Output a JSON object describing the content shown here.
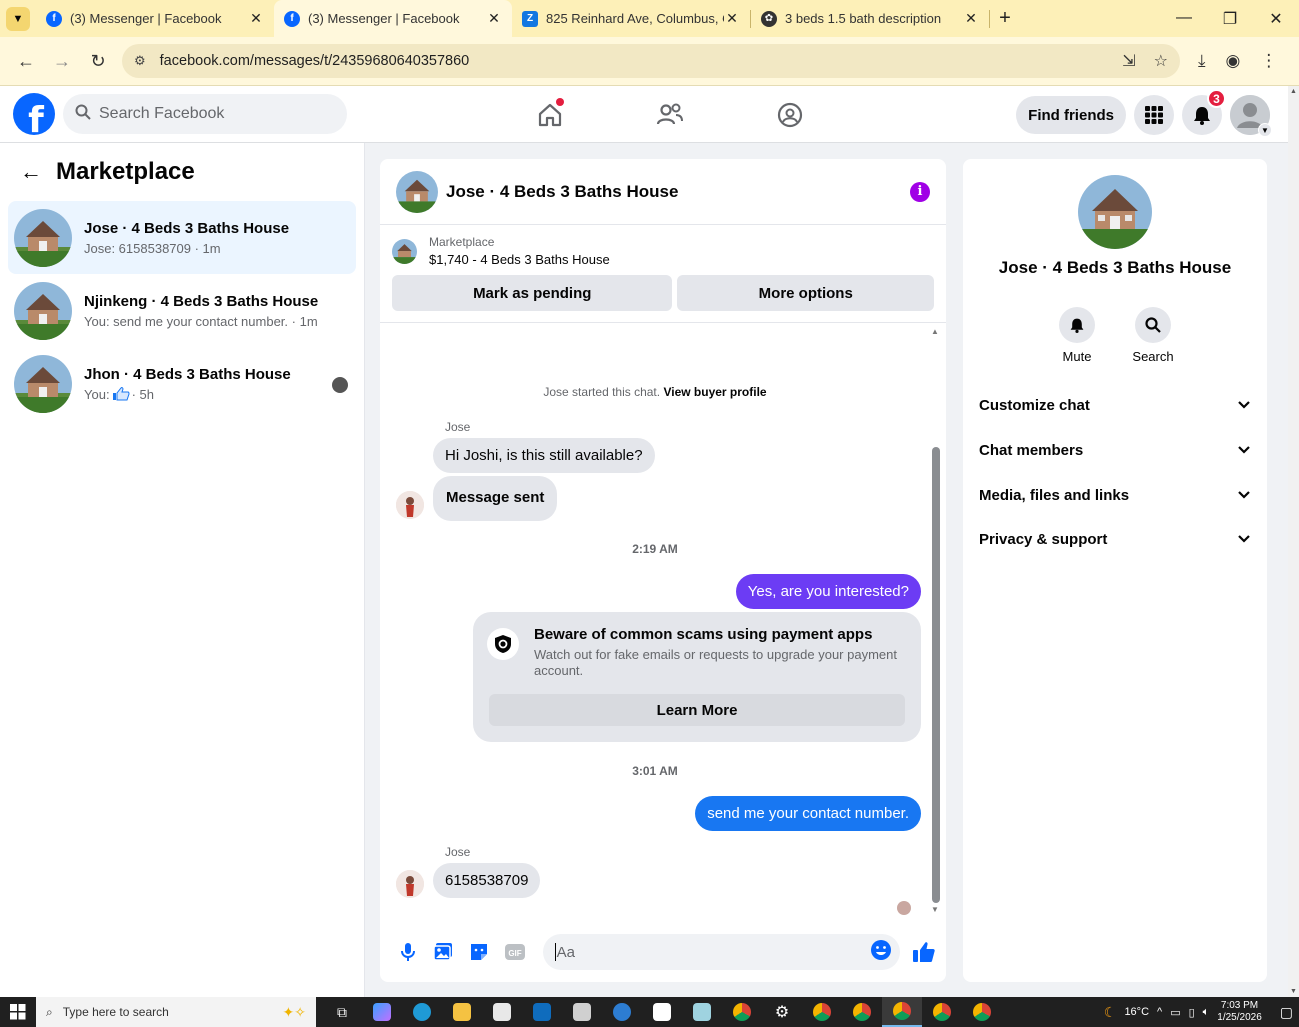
{
  "browser": {
    "tabs": [
      {
        "title": "(3) Messenger | Facebook",
        "icon": "facebook-icon",
        "active": false
      },
      {
        "title": "(3) Messenger | Facebook",
        "icon": "facebook-icon",
        "active": true
      },
      {
        "title": "825 Reinhard Ave, Columbus, O",
        "icon": "zillow-icon",
        "active": false
      },
      {
        "title": "3 beds 1.5 bath description",
        "icon": "chatgpt-icon",
        "active": false
      }
    ],
    "url": "facebook.com/messages/t/24359680640357860"
  },
  "fb": {
    "search_placeholder": "Search Facebook",
    "find_friends": "Find friends",
    "notifications_count": "3"
  },
  "left": {
    "title": "Marketplace",
    "conversations": [
      {
        "name": "Jose · 4 Beds 3 Baths House",
        "snippet": "Jose: 6158538709 · 1m",
        "selected": true
      },
      {
        "name": "Njinkeng · 4 Beds 3 Baths House",
        "snippet": "You: send me your contact number. · 1m",
        "selected": false
      },
      {
        "name": "Jhon · 4 Beds 3 Baths House",
        "snippet_prefix": "You:",
        "snippet_suffix": "· 5h",
        "selected": false
      }
    ]
  },
  "chat": {
    "title": "Jose · 4 Beds 3 Baths House",
    "listing_kicker": "Marketplace",
    "listing_price": "$1,740 - 4 Beds 3 Baths House",
    "mark_pending": "Mark as pending",
    "more_options": "More options",
    "started_text": "Jose started this chat.",
    "view_profile": "View buyer profile",
    "sender1": "Jose",
    "msg1": "Hi Joshi, is this still available?",
    "msg2": "Message sent",
    "time1": "2:19 AM",
    "msg3": "Yes, are you interested?",
    "scam_head": "Beware of common scams using payment apps",
    "scam_body": "Watch out for fake emails or requests to upgrade your payment account.",
    "learn_more": "Learn More",
    "time2": "3:01 AM",
    "msg4": "send me your contact number.",
    "sender2": "Jose",
    "msg5": "6158538709",
    "composer_placeholder": "Aa"
  },
  "right": {
    "name": "Jose · 4 Beds 3 Baths House",
    "mute": "Mute",
    "search": "Search",
    "sections": [
      "Customize chat",
      "Chat members",
      "Media, files and links",
      "Privacy & support"
    ]
  },
  "taskbar": {
    "search": "Type here to search",
    "temp": "16°C",
    "time": "7:03 PM",
    "date": "1/25/2026"
  }
}
